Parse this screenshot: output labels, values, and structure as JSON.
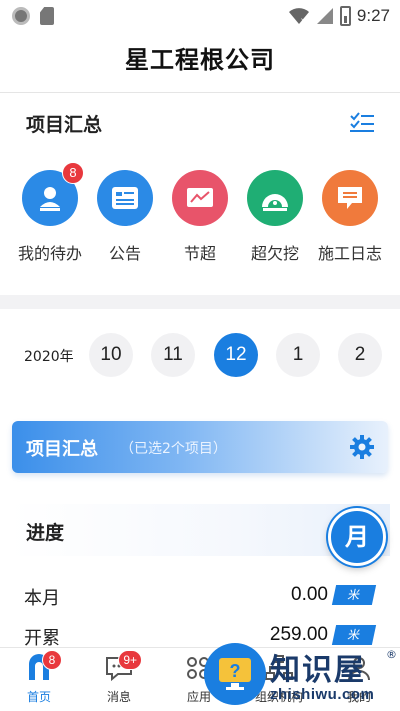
{
  "status_bar": {
    "time": "9:27"
  },
  "header": {
    "title": "星工程根公司"
  },
  "summary": {
    "title": "项目汇总",
    "actions": [
      {
        "label": "我的待办",
        "badge": "8",
        "color": "#2b8ae6",
        "icon": "person-badge-icon"
      },
      {
        "label": "公告",
        "badge": "",
        "color": "#2b8ae6",
        "icon": "notice-card-icon"
      },
      {
        "label": "节超",
        "badge": "",
        "color": "#e8546a",
        "icon": "trend-chart-icon"
      },
      {
        "label": "超欠挖",
        "badge": "",
        "color": "#1fae74",
        "icon": "tunnel-gauge-icon"
      },
      {
        "label": "施工日志",
        "badge": "",
        "color": "#f07a3c",
        "icon": "log-message-icon"
      }
    ]
  },
  "date_selector": {
    "year": "2020年",
    "months": [
      "10",
      "11",
      "12",
      "1",
      "2"
    ],
    "active_index": 2
  },
  "project_banner": {
    "title": "项目汇总",
    "subtitle": "（已选2个项目）"
  },
  "progress": {
    "title": "进度",
    "period_button": "月",
    "rows": [
      {
        "label": "本月",
        "value": "0.00",
        "unit": "米"
      },
      {
        "label": "开累",
        "value": "259.00",
        "unit": "米"
      }
    ]
  },
  "bottom_nav": {
    "items": [
      {
        "label": "首页",
        "badge": "8",
        "active": true
      },
      {
        "label": "消息",
        "badge": "9+",
        "active": false
      },
      {
        "label": "应用",
        "badge": "",
        "active": false
      },
      {
        "label": "组织机构",
        "badge": "",
        "active": false
      },
      {
        "label": "我的",
        "badge": "",
        "active": false
      }
    ]
  },
  "watermark": {
    "title": "知识屋",
    "url": "zhishiwu.com",
    "registered_mark": "®"
  },
  "colors": {
    "primary": "#1a7ee0",
    "badge": "#e8383d"
  }
}
